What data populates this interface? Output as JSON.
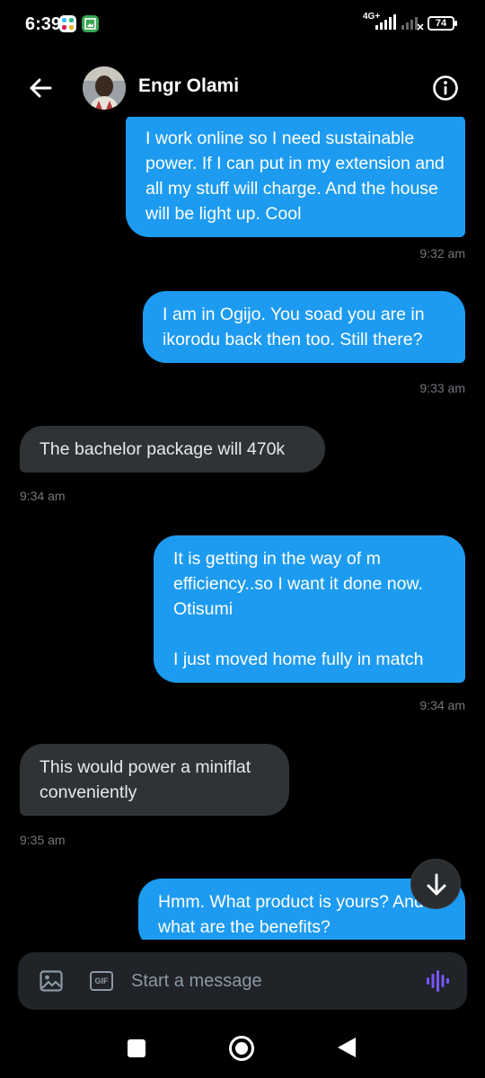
{
  "status_bar": {
    "time": "6:39",
    "network": "4G+",
    "battery": "74"
  },
  "header": {
    "contact_name": "Engr Olami",
    "back_icon": "arrow-left-icon",
    "info_icon": "info-circle-icon"
  },
  "messages": [
    {
      "direction": "sent",
      "text": "I work online so I need sustainable power. If I can put in my extension and all my stuff will charge. And the house will be light up. Cool",
      "time": "9:32 am"
    },
    {
      "direction": "sent",
      "text": "I am in Ogijo. You soad you are in ikorodu back then too. Still there?",
      "time": "9:33 am"
    },
    {
      "direction": "received",
      "text": "The bachelor package will 470k",
      "time": "9:34 am"
    },
    {
      "direction": "sent",
      "text": "It is getting in the way of m efficiency..so I want it done now. Otisumi\n\nI just moved home fully in match",
      "time": "9:34 am"
    },
    {
      "direction": "received",
      "text": "This would power a miniflat conveniently",
      "time": "9:35 am"
    },
    {
      "direction": "sent",
      "text": "Hmm. What product is yours? And what are the benefits?",
      "time": ""
    }
  ],
  "composer": {
    "placeholder": "Start a message",
    "image_icon": "image-icon",
    "gif_label": "GIF",
    "voice_icon": "voice-wave-icon"
  },
  "colors": {
    "sent_bubble": "#1d9bf0",
    "received_bubble": "#2f3336",
    "background": "#000000",
    "voice_accent": "#7856ff"
  }
}
